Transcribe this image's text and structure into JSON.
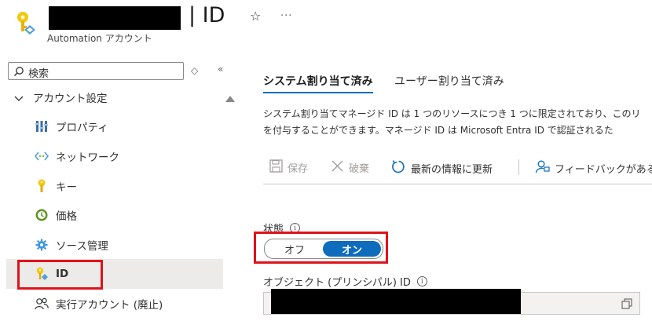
{
  "header": {
    "title": "| ID",
    "subtitle": "Automation アカウント",
    "favorite_icon": "star-icon",
    "more_label": "···"
  },
  "sidebar": {
    "search": {
      "placeholder": "検索"
    },
    "section": {
      "label": "アカウント設定",
      "expanded": true
    },
    "items": [
      {
        "label": "プロパティ",
        "icon": "properties-icon",
        "selected": false
      },
      {
        "label": "ネットワーク",
        "icon": "networking-icon",
        "selected": false
      },
      {
        "label": "キー",
        "icon": "key-icon",
        "selected": false
      },
      {
        "label": "価格",
        "icon": "pricing-icon",
        "selected": false
      },
      {
        "label": "ソース管理",
        "icon": "source-control-icon",
        "selected": false
      },
      {
        "label": "ID",
        "icon": "identity-icon",
        "selected": true
      },
      {
        "label": "実行アカウント (廃止)",
        "icon": "run-as-accounts-icon",
        "selected": false
      }
    ]
  },
  "tabs": [
    {
      "label": "システム割り当て済み",
      "active": true
    },
    {
      "label": "ユーザー割り当て済み",
      "active": false
    }
  ],
  "description": {
    "line1": "システム割り当てマネージド ID は 1 つのリソースにつき 1 つに限定されており、このリ",
    "line2": "を付与することができます。マネージド ID は Microsoft Entra ID で認証されるた"
  },
  "commands": {
    "save": "保存",
    "discard": "破棄",
    "refresh": "最新の情報に更新",
    "feedback": "フィードバックがある場"
  },
  "status": {
    "label": "状態",
    "off_label": "オフ",
    "on_label": "オン",
    "value": "オン"
  },
  "object_id": {
    "label": "オブジェクト (プリンシパル) ID"
  },
  "colors": {
    "accent": "#0f6cbd",
    "highlight_frame": "#e0121a",
    "selected_bg": "#edebe9"
  }
}
